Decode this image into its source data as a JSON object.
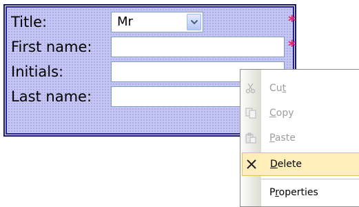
{
  "form": {
    "fields": [
      {
        "label": "Title:",
        "type": "select",
        "value": "Mr",
        "required": true
      },
      {
        "label": "First name:",
        "type": "text",
        "value": "",
        "required": true
      },
      {
        "label": "Initials:",
        "type": "text",
        "value": "",
        "required": false
      },
      {
        "label": "Last name:",
        "type": "text",
        "value": "",
        "required": false
      }
    ],
    "required_marker": "*",
    "colors": {
      "border": "#14146e",
      "fill": "#c6c6f4",
      "required": "#e8246e"
    }
  },
  "context_menu": {
    "items": [
      {
        "label_pre": "Cu",
        "label_key": "t",
        "label_post": "",
        "icon": "scissors-icon",
        "enabled": false
      },
      {
        "label_pre": "",
        "label_key": "C",
        "label_post": "opy",
        "icon": "copy-icon",
        "enabled": false
      },
      {
        "label_pre": "",
        "label_key": "P",
        "label_post": "aste",
        "icon": "paste-icon",
        "enabled": false
      },
      {
        "label_pre": "",
        "label_key": "D",
        "label_post": "elete",
        "icon": "delete-x-icon",
        "enabled": true,
        "highlighted": true
      },
      {
        "label_pre": "P",
        "label_key": "r",
        "label_post": "operties",
        "icon": "",
        "enabled": true
      }
    ],
    "colors": {
      "highlight": "#ffeeb9",
      "highlight_border": "#e5c365",
      "disabled_text": "#9d9d9d"
    }
  }
}
